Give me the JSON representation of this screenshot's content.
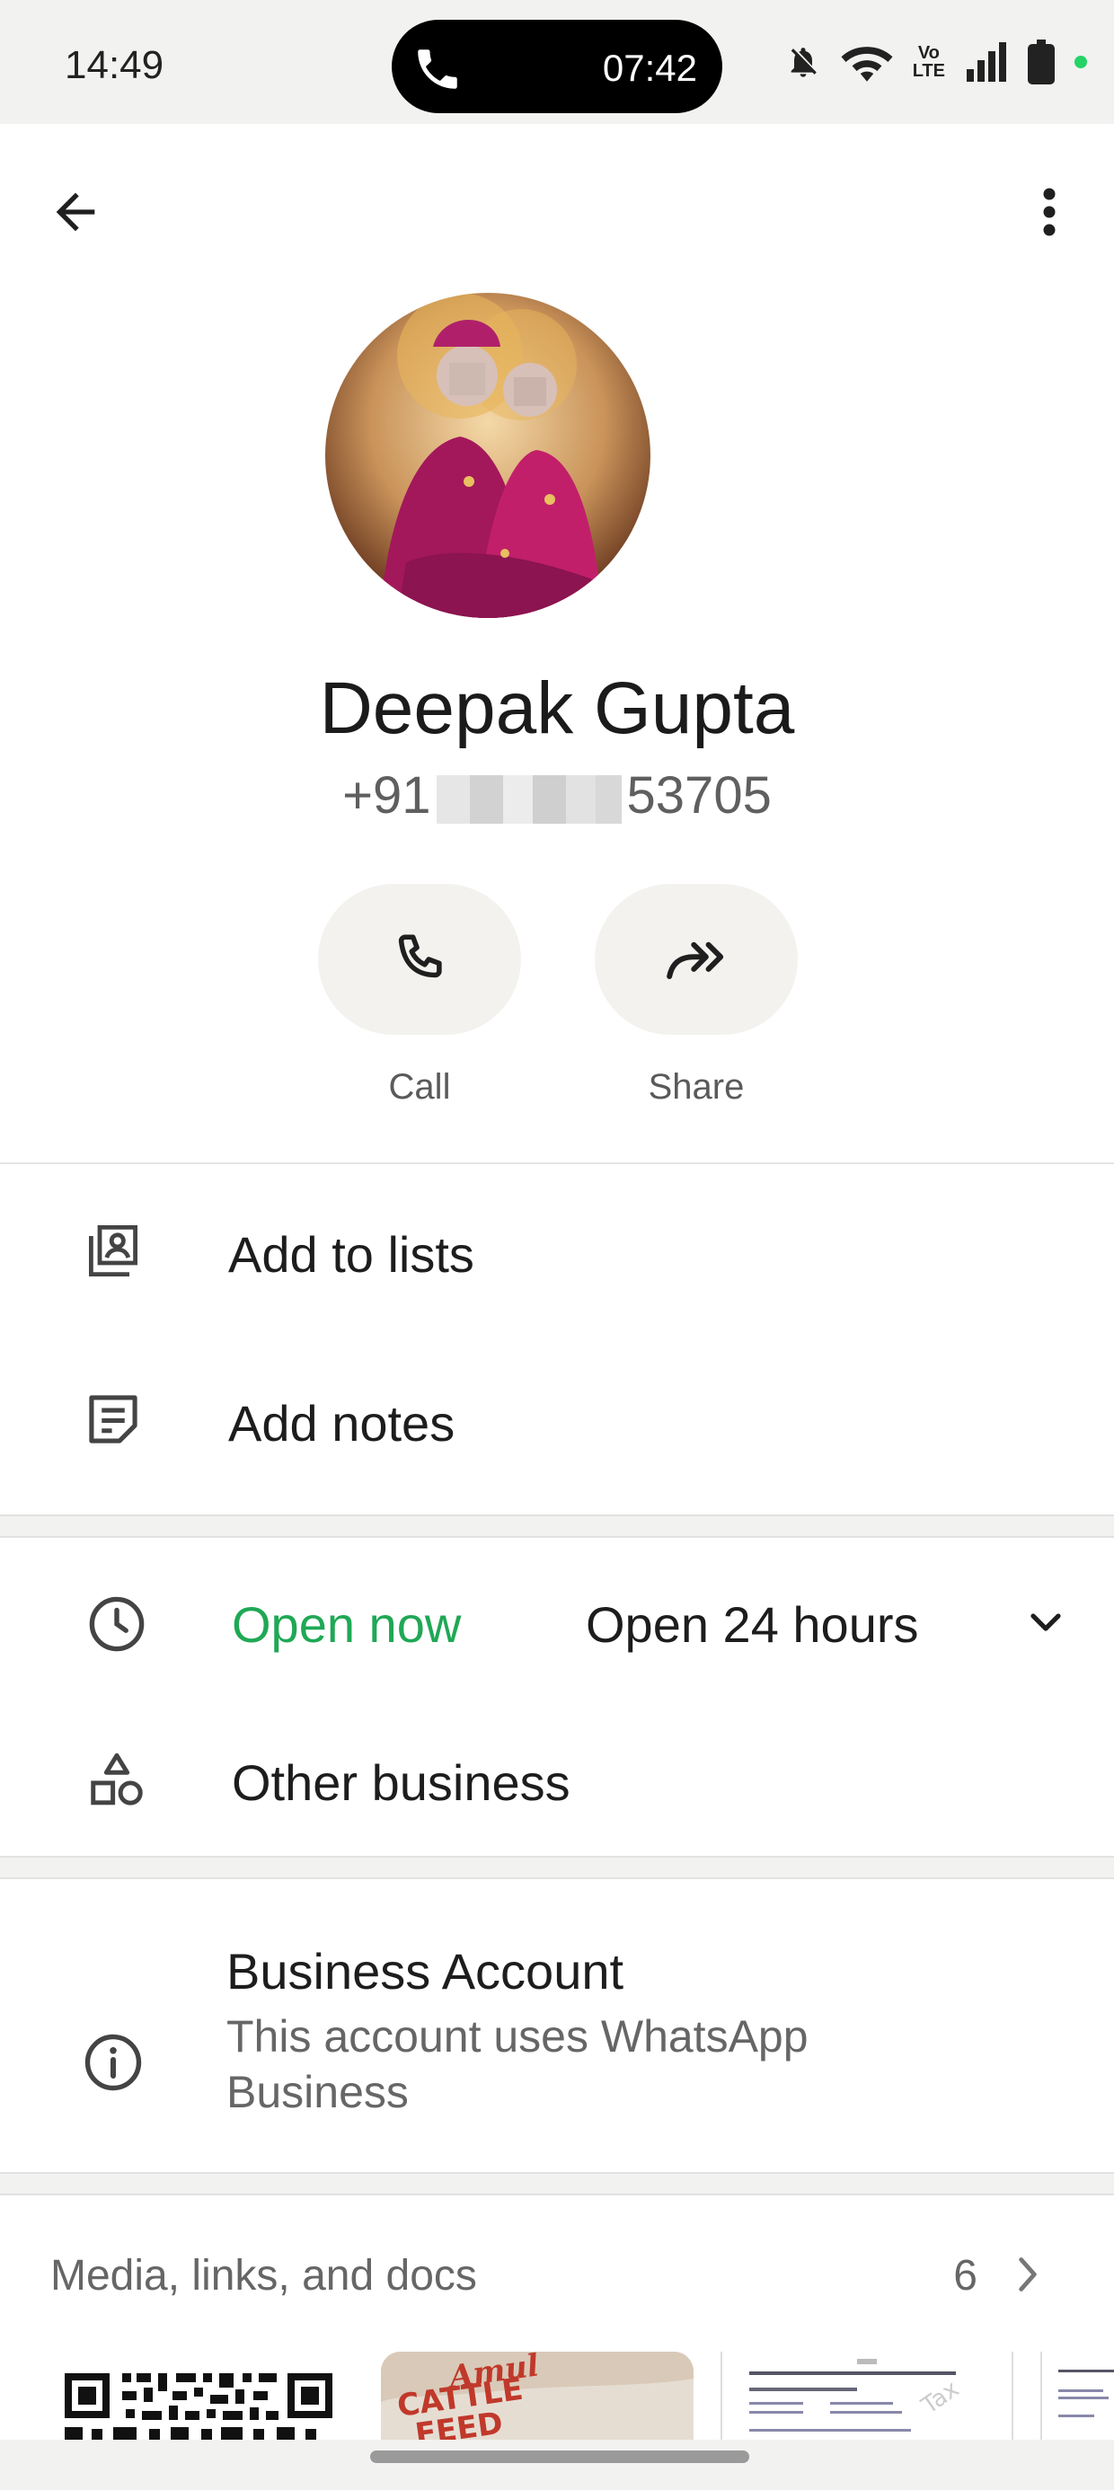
{
  "status_bar": {
    "time": "14:49",
    "call_timer": "07:42",
    "network_label": "Vo\nLTE",
    "accent_dot_color": "#25d366"
  },
  "header": {
    "back_icon": "arrow-left-icon",
    "menu_icon": "more-vert-icon"
  },
  "profile": {
    "name": "Deepak Gupta",
    "phone_prefix": "+91",
    "phone_suffix": "53705"
  },
  "actions": [
    {
      "label": "Call",
      "icon": "phone-icon"
    },
    {
      "label": "Share",
      "icon": "forward-icon"
    }
  ],
  "menu_items": {
    "add_to_lists": "Add to lists",
    "add_notes": "Add notes"
  },
  "business_hours": {
    "status": "Open now",
    "status_color": "#1fa855",
    "hours": "Open 24 hours"
  },
  "category": "Other business",
  "business_account": {
    "title": "Business Account",
    "description": "This account uses WhatsApp Business"
  },
  "media": {
    "heading": "Media, links, and docs",
    "count": "6",
    "thumbnail_texts": [
      "Amul",
      "CATTLE",
      "FEED"
    ]
  }
}
